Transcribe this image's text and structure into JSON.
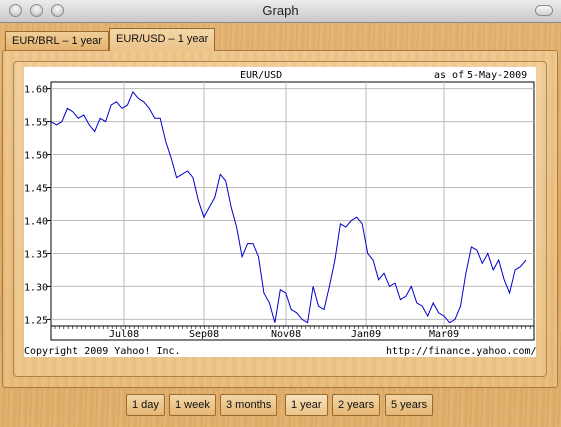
{
  "window": {
    "title": "Graph"
  },
  "tabs": [
    {
      "label": "EUR/BRL – 1 year",
      "active": false
    },
    {
      "label": "EUR/USD – 1 year",
      "active": true
    }
  ],
  "chart_header": {
    "title": "EUR/USD",
    "as_of_label": "as of",
    "as_of_date": "5-May-2009"
  },
  "chart_footer": {
    "copyright": "Copyright 2009 Yahoo! Inc.",
    "source": "http://finance.yahoo.com/"
  },
  "range_buttons": [
    {
      "label": "1 day",
      "selected": false
    },
    {
      "label": "1 week",
      "selected": false
    },
    {
      "label": "3 months",
      "selected": false
    },
    {
      "label": "1 year",
      "selected": true
    },
    {
      "label": "2 years",
      "selected": false
    },
    {
      "label": "5 years",
      "selected": false
    }
  ],
  "colors": {
    "line": "#0000cc",
    "grid": "#bbbbbb",
    "wood": "#e2b06c"
  },
  "chart_data": {
    "type": "line",
    "title": "EUR/USD",
    "xlabel": "",
    "ylabel": "",
    "grid": true,
    "ylim": [
      1.24,
      1.61
    ],
    "y_ticks": [
      1.25,
      1.3,
      1.35,
      1.4,
      1.45,
      1.5,
      1.55,
      1.6
    ],
    "y_tick_labels": [
      "1.25",
      "1.30",
      "1.35",
      "1.40",
      "1.45",
      "1.50",
      "1.55",
      "1.60"
    ],
    "x_ticks": [
      "Jul08",
      "Sep08",
      "Nov08",
      "Jan09",
      "Mar09"
    ],
    "series": [
      {
        "values": [
          1.55,
          1.545,
          1.55,
          1.57,
          1.565,
          1.555,
          1.56,
          1.545,
          1.535,
          1.555,
          1.55,
          1.575,
          1.58,
          1.57,
          1.575,
          1.595,
          1.585,
          1.58,
          1.57,
          1.555,
          1.555,
          1.52,
          1.495,
          1.465,
          1.47,
          1.475,
          1.465,
          1.43,
          1.405,
          1.42,
          1.435,
          1.47,
          1.46,
          1.42,
          1.39,
          1.345,
          1.365,
          1.365,
          1.345,
          1.29,
          1.275,
          1.245,
          1.295,
          1.29,
          1.265,
          1.26,
          1.25,
          1.245,
          1.3,
          1.27,
          1.265,
          1.3,
          1.34,
          1.395,
          1.39,
          1.4,
          1.405,
          1.395,
          1.35,
          1.34,
          1.31,
          1.32,
          1.3,
          1.305,
          1.28,
          1.285,
          1.3,
          1.275,
          1.27,
          1.255,
          1.275,
          1.26,
          1.255,
          1.245,
          1.25,
          1.27,
          1.32,
          1.36,
          1.355,
          1.335,
          1.35,
          1.325,
          1.34,
          1.31,
          1.29,
          1.325,
          1.33,
          1.34
        ]
      }
    ]
  }
}
